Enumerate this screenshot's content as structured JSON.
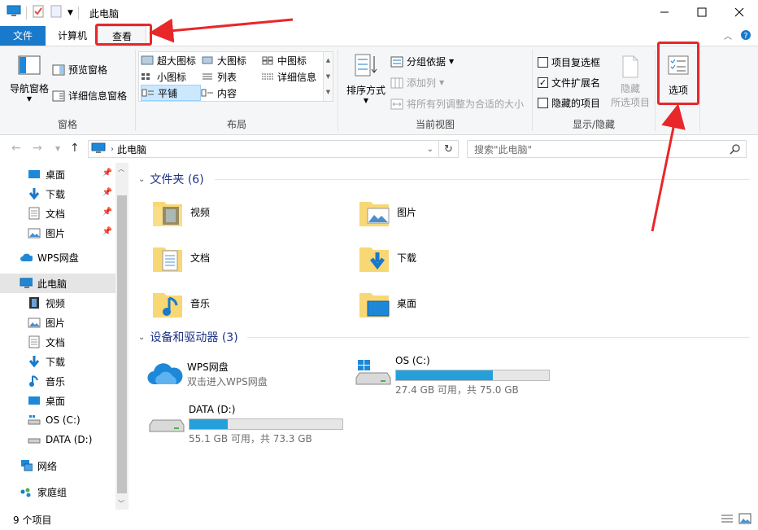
{
  "window": {
    "title": "此电脑"
  },
  "tabs": {
    "file": "文件",
    "computer": "计算机",
    "view": "查看"
  },
  "ribbon": {
    "panes": {
      "nav_pane": "导航窗格",
      "preview_pane": "预览窗格",
      "details_pane": "详细信息窗格",
      "group_title": "窗格"
    },
    "layout": {
      "items": [
        "超大图标",
        "大图标",
        "中图标",
        "小图标",
        "列表",
        "详细信息",
        "平铺",
        "内容"
      ],
      "group_title": "布局"
    },
    "current_view": {
      "sort_by": "排序方式",
      "group_by": "分组依据",
      "add_columns": "添加列",
      "fit_columns": "将所有列调整为合适的大小",
      "group_title": "当前视图"
    },
    "show_hide": {
      "item_checkboxes": "项目复选框",
      "file_extensions": "文件扩展名",
      "hidden_items": "隐藏的项目",
      "hide_selected_1": "隐藏",
      "hide_selected_2": "所选项目",
      "group_title": "显示/隐藏",
      "file_extensions_checked": true
    },
    "options": {
      "label": "选项"
    }
  },
  "address": {
    "path": "此电脑",
    "search_placeholder": "搜索\"此电脑\""
  },
  "nav_pane": {
    "quick_access": [
      "桌面",
      "下载",
      "文档",
      "图片"
    ],
    "wps": "WPS网盘",
    "this_pc": "此电脑",
    "this_pc_children": [
      "视频",
      "图片",
      "文档",
      "下载",
      "音乐",
      "桌面",
      "OS (C:)",
      "DATA (D:)"
    ],
    "network": "网络",
    "homegroup": "家庭组"
  },
  "content": {
    "folders_header": "文件夹 (6)",
    "folders": [
      "视频",
      "图片",
      "文档",
      "下载",
      "音乐",
      "桌面"
    ],
    "devices_header": "设备和驱动器 (3)",
    "devices": [
      {
        "name": "WPS网盘",
        "sub": "双击进入WPS网盘"
      },
      {
        "name": "OS (C:)",
        "sub": "27.4 GB 可用，共 75.0 GB",
        "used_fraction": 0.635
      },
      {
        "name": "DATA (D:)",
        "sub": "55.1 GB 可用，共 73.3 GB",
        "used_fraction": 0.248
      }
    ]
  },
  "status": {
    "count": "9 个项目"
  },
  "colors": {
    "accent": "#1979ca",
    "annotation": "#e8272a",
    "drive_bar": "#26a0da",
    "group_header": "#1e3287"
  }
}
